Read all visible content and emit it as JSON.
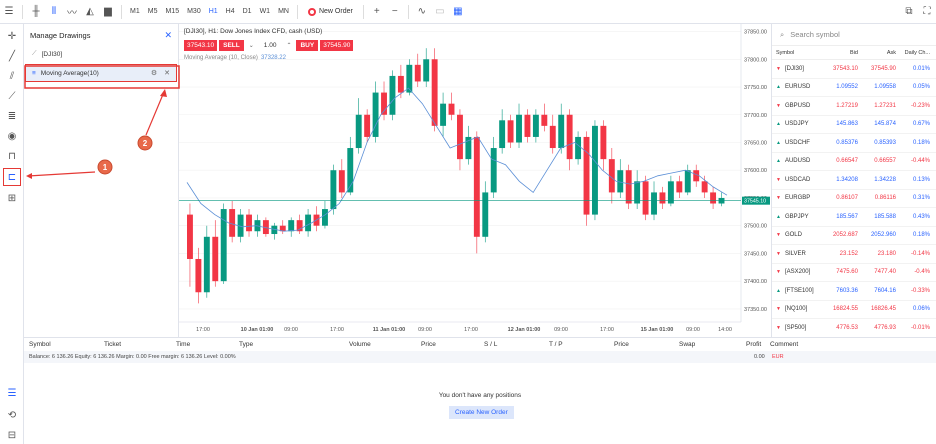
{
  "toolbar": {
    "timeframes": [
      "M1",
      "M5",
      "M15",
      "M30",
      "H1",
      "H4",
      "D1",
      "W1",
      "MN"
    ],
    "active_timeframe": "H1",
    "new_order_label": "New Order"
  },
  "drawings_panel": {
    "title": "Manage Drawings",
    "symbol_row": "[DJI30]",
    "indicator_row": "Moving Average(10)"
  },
  "chart": {
    "title": "[DJI30], H1: Dow Jones Index CFD, cash (USD)",
    "sell_price": "37543.10",
    "sell_label": "SELL",
    "quantity": "1.00",
    "buy_label": "BUY",
    "buy_price": "37545.90",
    "ma_label": "Moving Average (10, Close)",
    "ma_value": "37328.22",
    "current_price_label": "37545.10",
    "colors": {
      "up": "#089981",
      "down": "#f23645",
      "ma": "#5b8fd6"
    }
  },
  "chart_data": {
    "type": "line",
    "series": [
      {
        "name": "Moving Average (10, Close)",
        "values": [
          37578,
          37540,
          37520,
          37505,
          37498,
          37500,
          37495,
          37490,
          37492,
          37505,
          37520,
          37540,
          37580,
          37650,
          37700,
          37730,
          37748,
          37720,
          37680,
          37640,
          37650,
          37660,
          37620,
          37610,
          37580,
          37560,
          37600,
          37640,
          37650,
          37630,
          37600,
          37580,
          37575,
          37580,
          37590,
          37595,
          37600,
          37590,
          37570,
          37555
        ]
      }
    ],
    "x_ticks": [
      "17:00",
      "10 Jan 01:00",
      "09:00",
      "17:00",
      "11 Jan 01:00",
      "09:00",
      "17:00",
      "12 Jan 01:00",
      "09:00",
      "17:00",
      "15 Jan 01:00",
      "09:00",
      "14:00"
    ],
    "y_ticks": [
      "37850.00",
      "37800.00",
      "37750.00",
      "37700.00",
      "37650.00",
      "37600.00",
      "37550.00",
      "37500.00",
      "37450.00",
      "37400.00",
      "37350.00"
    ],
    "ylim": [
      37330,
      37860
    ]
  },
  "watchlist": {
    "search_placeholder": "Search symbol",
    "headers": {
      "symbol": "Symbol",
      "bid": "Bid",
      "ask": "Ask",
      "change": "Daily Ch..."
    },
    "rows": [
      {
        "symbol": "[DJI30]",
        "bid": "37543.10",
        "ask": "37545.90",
        "change": "0.01%",
        "dir": "dn",
        "bid_c": "red",
        "ask_c": "red",
        "chg_c": "blue"
      },
      {
        "symbol": "EURUSD",
        "bid": "1.09552",
        "ask": "1.09558",
        "change": "0.05%",
        "dir": "up",
        "bid_c": "blue",
        "ask_c": "blue",
        "chg_c": "blue"
      },
      {
        "symbol": "GBPUSD",
        "bid": "1.27219",
        "ask": "1.27231",
        "change": "-0.23%",
        "dir": "dn",
        "bid_c": "red",
        "ask_c": "red",
        "chg_c": "red"
      },
      {
        "symbol": "USDJPY",
        "bid": "145.863",
        "ask": "145.874",
        "change": "0.67%",
        "dir": "up",
        "bid_c": "blue",
        "ask_c": "blue",
        "chg_c": "blue"
      },
      {
        "symbol": "USDCHF",
        "bid": "0.85376",
        "ask": "0.85393",
        "change": "0.18%",
        "dir": "up",
        "bid_c": "blue",
        "ask_c": "blue",
        "chg_c": "blue"
      },
      {
        "symbol": "AUDUSD",
        "bid": "0.66547",
        "ask": "0.66557",
        "change": "-0.44%",
        "dir": "up",
        "bid_c": "red",
        "ask_c": "red",
        "chg_c": "red"
      },
      {
        "symbol": "USDCAD",
        "bid": "1.34208",
        "ask": "1.34228",
        "change": "0.13%",
        "dir": "dn",
        "bid_c": "blue",
        "ask_c": "blue",
        "chg_c": "blue"
      },
      {
        "symbol": "EURGBP",
        "bid": "0.86107",
        "ask": "0.86116",
        "change": "0.31%",
        "dir": "dn",
        "bid_c": "red",
        "ask_c": "red",
        "chg_c": "blue"
      },
      {
        "symbol": "GBPJPY",
        "bid": "185.567",
        "ask": "185.588",
        "change": "0.43%",
        "dir": "up",
        "bid_c": "blue",
        "ask_c": "blue",
        "chg_c": "blue"
      },
      {
        "symbol": "GOLD",
        "bid": "2052.687",
        "ask": "2052.960",
        "change": "0.18%",
        "dir": "dn",
        "bid_c": "red",
        "ask_c": "blue",
        "chg_c": "blue"
      },
      {
        "symbol": "SILVER",
        "bid": "23.152",
        "ask": "23.180",
        "change": "-0.14%",
        "dir": "dn",
        "bid_c": "red",
        "ask_c": "red",
        "chg_c": "red"
      },
      {
        "symbol": "[ASX200]",
        "bid": "7475.60",
        "ask": "7477.40",
        "change": "-0.4%",
        "dir": "dn",
        "bid_c": "red",
        "ask_c": "red",
        "chg_c": "red"
      },
      {
        "symbol": "[FTSE100]",
        "bid": "7603.36",
        "ask": "7604.16",
        "change": "-0.33%",
        "dir": "up",
        "bid_c": "blue",
        "ask_c": "blue",
        "chg_c": "red"
      },
      {
        "symbol": "[NQ100]",
        "bid": "16824.55",
        "ask": "16826.45",
        "change": "0.06%",
        "dir": "dn",
        "bid_c": "red",
        "ask_c": "red",
        "chg_c": "blue"
      },
      {
        "symbol": "[SP500]",
        "bid": "4776.53",
        "ask": "4776.93",
        "change": "-0.01%",
        "dir": "dn",
        "bid_c": "red",
        "ask_c": "red",
        "chg_c": "red"
      }
    ]
  },
  "positions": {
    "headers": [
      "Symbol",
      "Ticket",
      "Time",
      "Type",
      "Volume",
      "Price",
      "S / L",
      "T / P",
      "Price",
      "Swap",
      "Profit",
      "Comment"
    ],
    "balance_line": "Balance: 6 136.26   Equity: 6 136.26   Margin: 0.00   Free margin: 6 136.26   Level: 0.00%",
    "profit_value": "0.00",
    "currency": "EUR",
    "empty_message": "You don't have any positions",
    "create_button": "Create New Order"
  },
  "annotations": {
    "marker_1": "1",
    "marker_2": "2",
    "color": "#e53935"
  }
}
